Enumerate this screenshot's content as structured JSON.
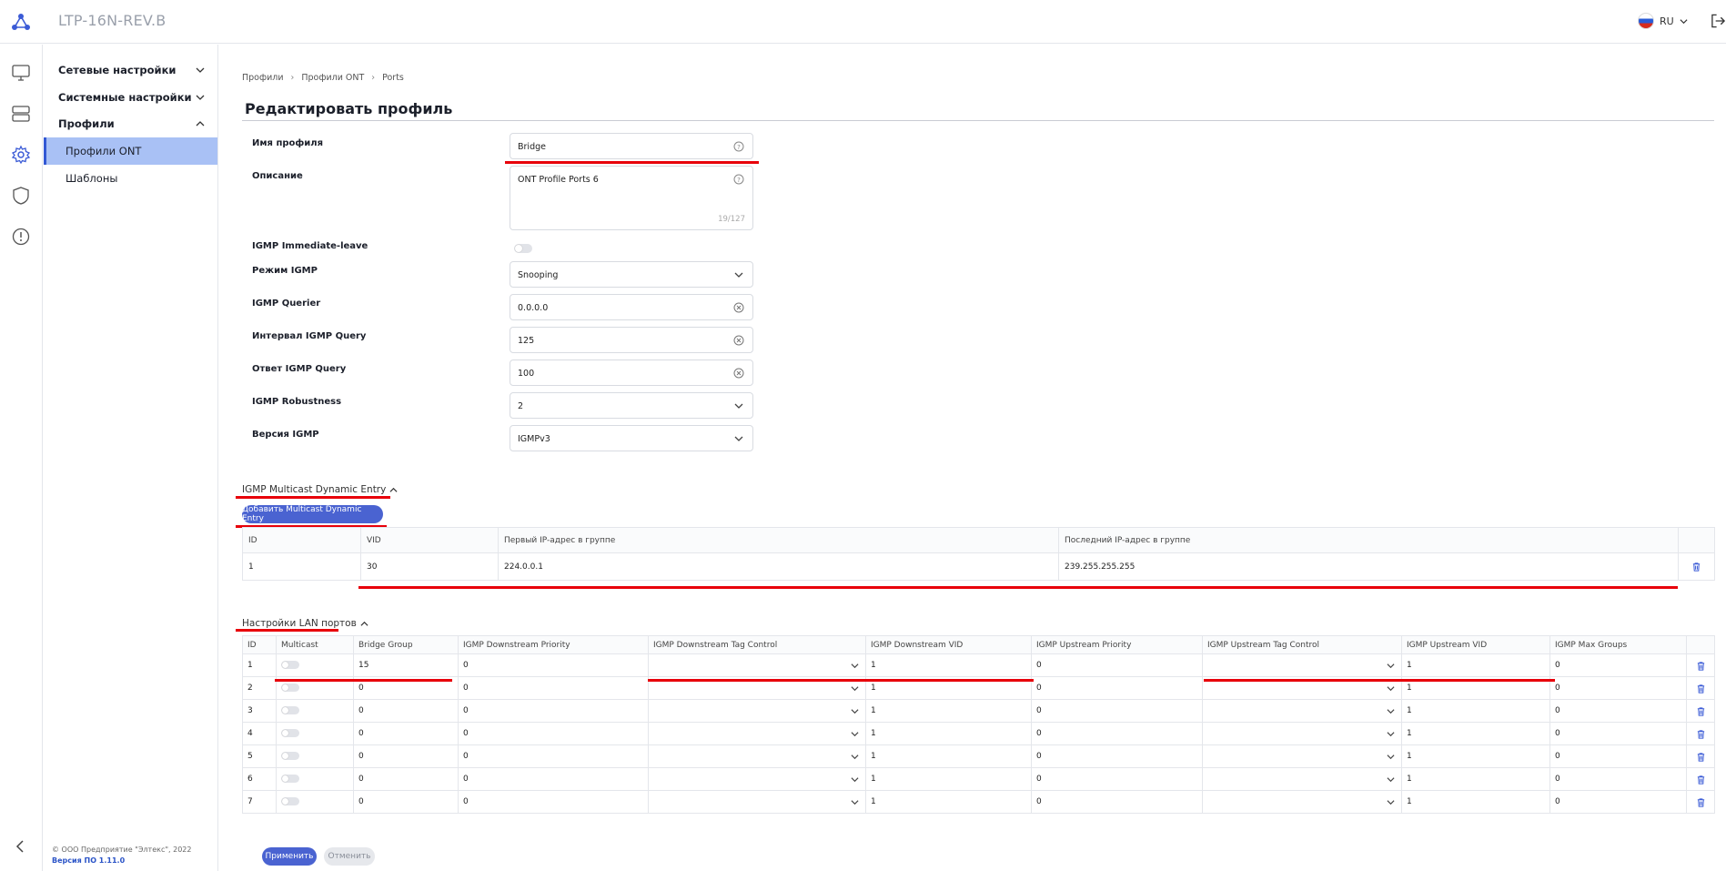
{
  "app": {
    "title": "LTP-16N-REV.B",
    "lang": "RU"
  },
  "rail": [
    "monitor-icon",
    "server-icon",
    "gear-icon",
    "shield-icon",
    "alert-icon"
  ],
  "nav": {
    "items": [
      {
        "label": "Сетевые настройки",
        "expanded": false
      },
      {
        "label": "Системные настройки",
        "expanded": false
      },
      {
        "label": "Профили",
        "expanded": true
      }
    ],
    "subitems": [
      {
        "label": "Профили ONT",
        "active": true
      },
      {
        "label": "Шаблоны",
        "active": false
      }
    ],
    "copyright": "© ООО Предприятие \"Элтекс\", 2022",
    "version": "Версия ПО 1.11.0"
  },
  "breadcrumb": [
    "Профили",
    "Профили ONT",
    "Ports"
  ],
  "page_title": "Редактировать профиль",
  "form": {
    "profile_name": {
      "label": "Имя профиля",
      "value": "Bridge"
    },
    "description": {
      "label": "Описание",
      "value": "ONT Profile Ports 6",
      "counter": "19/127"
    },
    "immediate_leave": {
      "label": "IGMP Immediate-leave"
    },
    "igmp_mode": {
      "label": "Режим IGMP",
      "value": "Snooping"
    },
    "igmp_querier": {
      "label": "IGMP Querier",
      "value": "0.0.0.0"
    },
    "query_interval": {
      "label": "Интервал IGMP Query",
      "value": "125"
    },
    "query_response": {
      "label": "Ответ IGMP Query",
      "value": "100"
    },
    "robustness": {
      "label": "IGMP Robustness",
      "value": "2"
    },
    "igmp_version": {
      "label": "Версия IGMP",
      "value": "IGMPv3"
    }
  },
  "multicast": {
    "section_title": "IGMP Multicast Dynamic Entry",
    "add_button": "Добавить Multicast Dynamic Entry",
    "columns": [
      "ID",
      "VID",
      "Первый IP-адрес в группе",
      "Последний IP-адрес в группе"
    ],
    "rows": [
      {
        "id": "1",
        "vid": "30",
        "first_ip": "224.0.0.1",
        "last_ip": "239.255.255.255"
      }
    ]
  },
  "lan": {
    "section_title": "Настройки LAN портов",
    "columns": [
      "ID",
      "Multicast",
      "Bridge Group",
      "IGMP Downstream Priority",
      "IGMP Downstream Tag Control",
      "IGMP Downstream VID",
      "IGMP Upstream Priority",
      "IGMP Upstream Tag Control",
      "IGMP Upstream VID",
      "IGMP Max Groups"
    ],
    "rows": [
      {
        "id": "1",
        "bridge_group": "15",
        "ds_priority": "0",
        "ds_vid": "1",
        "us_priority": "0",
        "us_vid": "1",
        "max_groups": "0"
      },
      {
        "id": "2",
        "bridge_group": "0",
        "ds_priority": "0",
        "ds_vid": "1",
        "us_priority": "0",
        "us_vid": "1",
        "max_groups": "0"
      },
      {
        "id": "3",
        "bridge_group": "0",
        "ds_priority": "0",
        "ds_vid": "1",
        "us_priority": "0",
        "us_vid": "1",
        "max_groups": "0"
      },
      {
        "id": "4",
        "bridge_group": "0",
        "ds_priority": "0",
        "ds_vid": "1",
        "us_priority": "0",
        "us_vid": "1",
        "max_groups": "0"
      },
      {
        "id": "5",
        "bridge_group": "0",
        "ds_priority": "0",
        "ds_vid": "1",
        "us_priority": "0",
        "us_vid": "1",
        "max_groups": "0"
      },
      {
        "id": "6",
        "bridge_group": "0",
        "ds_priority": "0",
        "ds_vid": "1",
        "us_priority": "0",
        "us_vid": "1",
        "max_groups": "0"
      },
      {
        "id": "7",
        "bridge_group": "0",
        "ds_priority": "0",
        "ds_vid": "1",
        "us_priority": "0",
        "us_vid": "1",
        "max_groups": "0"
      }
    ]
  },
  "actions": {
    "apply": "Применить",
    "cancel": "Отменить"
  },
  "colors": {
    "accent": "#4a63d1",
    "active_nav": "#a9c1f5",
    "annotation": "#e8000a"
  }
}
